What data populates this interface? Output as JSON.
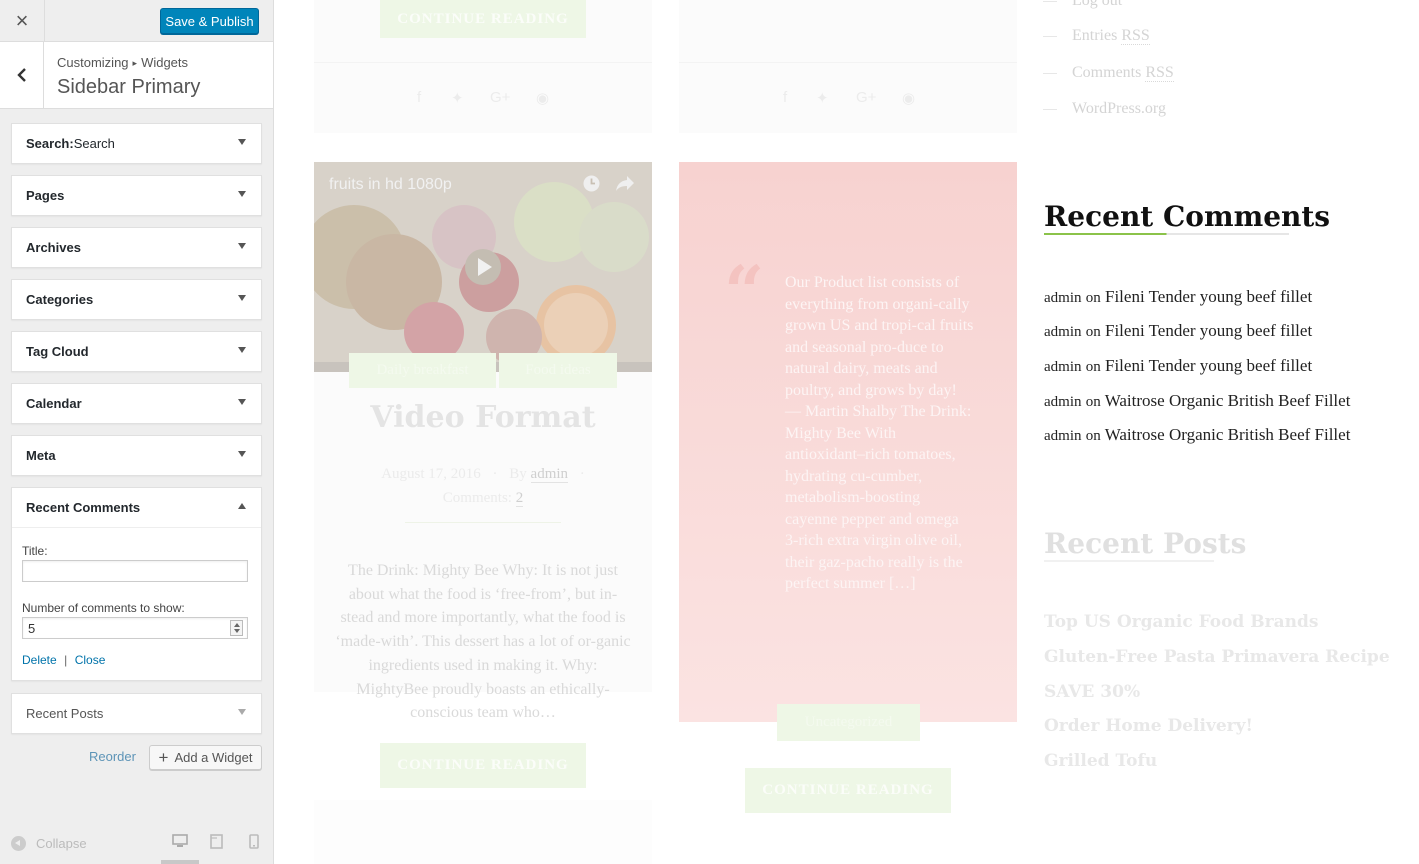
{
  "customizer": {
    "close_label": "×",
    "save_label": "Save & Publish",
    "breadcrumb": {
      "root": "Customizing",
      "sep": "▸",
      "leaf": "Widgets"
    },
    "section_title": "Sidebar Primary",
    "widgets": [
      {
        "name": "Search",
        "suffix": " Search"
      },
      {
        "name": "Pages"
      },
      {
        "name": "Archives"
      },
      {
        "name": "Categories"
      },
      {
        "name": "Tag Cloud"
      },
      {
        "name": "Calendar"
      },
      {
        "name": "Meta"
      }
    ],
    "recent_comments": {
      "name": "Recent Comments",
      "title_label": "Title:",
      "title_value": "",
      "number_label": "Number of comments to show:",
      "number_value": "5",
      "delete_label": "Delete",
      "separator": "|",
      "close_label": "Close"
    },
    "recent_posts_widget": "Recent Posts",
    "reorder_label": "Reorder",
    "add_widget_label": "Add a Widget",
    "collapse_label": "Collapse",
    "active_device": "desktop"
  },
  "preview": {
    "continue_reading": "CONTINUE READING",
    "video_title": "fruits in hd 1080p",
    "tags": [
      "Daily breakfast",
      "Food ideas"
    ],
    "post": {
      "title": "Video Format",
      "date": "August 17, 2016",
      "by": "By",
      "author": "admin",
      "comments_label": "Comments:",
      "comments_count": "2",
      "excerpt": "The Drink: Mighty Bee Why: It is not just about what the food is ‘free-from’, but in-stead and more importantly, what the food is ‘made-with’. This dessert has a lot of or-ganic ingredients used in making it. Why: MightyBee proudly boasts an ethically-conscious team who…"
    },
    "quote": {
      "text": "Our Product list consists of everything from organi-cally grown US and tropi-cal fruits and seasonal pro-duce to natural dairy, meats and poultry, and grows by day! — Martin Shalby The Drink: Mighty Bee With antioxidant–rich tomatoes, hydrating cu-cumber, metabolism-boosting cayenne pepper and omega 3-rich extra virgin olive oil, their gaz-pacho really is the perfect summer […]",
      "category": "Uncategorized"
    },
    "meta_links": [
      {
        "text": "Log out"
      },
      {
        "text": "Entries ",
        "rss": "RSS"
      },
      {
        "text": "Comments ",
        "rss": "RSS"
      },
      {
        "text": "WordPress.org"
      }
    ],
    "recent_comments_title": "Recent Comments",
    "recent_comments": [
      {
        "author": "admin",
        "on": "on",
        "post": "Fileni Tender young beef fillet"
      },
      {
        "author": "admin",
        "on": "on",
        "post": "Fileni Tender young beef fillet"
      },
      {
        "author": "admin",
        "on": "on",
        "post": "Fileni Tender young beef fillet"
      },
      {
        "author": "admin",
        "on": "on",
        "post": "Waitrose Organic British Beef Fillet"
      },
      {
        "author": "admin",
        "on": "on",
        "post": "Waitrose Organic British Beef Fillet"
      }
    ],
    "recent_posts_title": "Recent Posts",
    "recent_posts": [
      "Top US Organic Food Brands",
      "Gluten-Free Pasta Primavera Recipe",
      "SAVE 30%",
      "Order Home Delivery!",
      "Grilled Tofu"
    ],
    "colors": {
      "primary_button": "#0085ba",
      "link": "#0073aa",
      "accent_green": "#8bc34a",
      "quote_bg": "#f7d2d0"
    }
  }
}
